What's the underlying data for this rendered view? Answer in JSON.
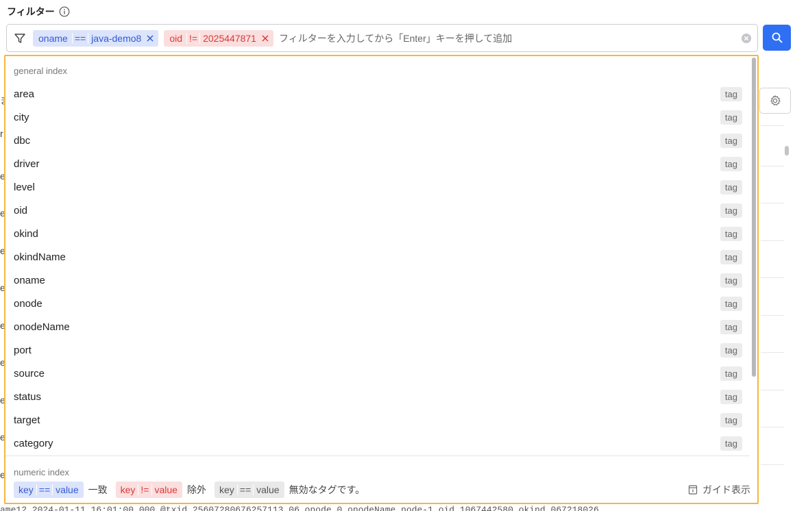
{
  "header": {
    "title": "フィルター",
    "info_icon": "info-circle-icon"
  },
  "filter": {
    "filter_icon": "funnel-icon",
    "chips": [
      {
        "key": "oname",
        "op": "==",
        "value": "java-demo8",
        "color": "#3459d6"
      },
      {
        "key": "oid",
        "op": "!=",
        "value": "2025447871",
        "color": "#d83a3a"
      }
    ],
    "input_placeholder": "フィルターを入力してから「Enter」キーを押して追加",
    "clear_icon": "clear-circle-icon",
    "search_icon": "search-icon",
    "search_color": "#2f6ff3"
  },
  "dropdown": {
    "border_color": "#f3b73a",
    "sections": [
      {
        "label": "general index",
        "items": [
          {
            "name": "area",
            "type": "tag"
          },
          {
            "name": "city",
            "type": "tag"
          },
          {
            "name": "dbc",
            "type": "tag"
          },
          {
            "name": "driver",
            "type": "tag"
          },
          {
            "name": "level",
            "type": "tag"
          },
          {
            "name": "oid",
            "type": "tag"
          },
          {
            "name": "okind",
            "type": "tag"
          },
          {
            "name": "okindName",
            "type": "tag"
          },
          {
            "name": "oname",
            "type": "tag"
          },
          {
            "name": "onode",
            "type": "tag"
          },
          {
            "name": "onodeName",
            "type": "tag"
          },
          {
            "name": "port",
            "type": "tag"
          },
          {
            "name": "source",
            "type": "tag"
          },
          {
            "name": "status",
            "type": "tag"
          },
          {
            "name": "target",
            "type": "tag"
          },
          {
            "name": "category",
            "type": "tag"
          }
        ]
      },
      {
        "label": "numeric index",
        "items": []
      }
    ],
    "legend": [
      {
        "key": "key",
        "op": "==",
        "value": "value",
        "desc": "一致",
        "color": "blue"
      },
      {
        "key": "key",
        "op": "!=",
        "value": "value",
        "desc": "除外",
        "color": "red"
      },
      {
        "key": "key",
        "op": "==",
        "value": "value",
        "desc": "無効なタグです。",
        "color": "gray"
      }
    ],
    "guide_label": "ガイド表示",
    "guide_icon": "guide-book-icon"
  },
  "background": {
    "gear_icon": "gear-icon",
    "left_fragments": [
      "ま",
      "r",
      "e",
      "e",
      "e",
      "e",
      "e",
      "e",
      "e",
      "e",
      "e"
    ],
    "bottom_text": "ame12   2024-01-11  16:01:00.000  @txid  25607280676257113 06  onode  0  onodeName  node-1  oid  1067442580  okind  067218026"
  }
}
